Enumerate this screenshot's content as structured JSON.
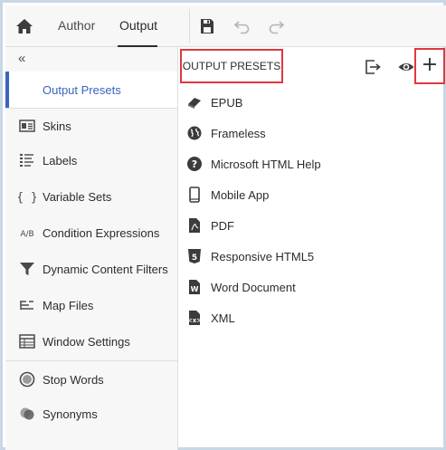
{
  "topbar": {
    "tabs": [
      {
        "label": "Author"
      },
      {
        "label": "Output"
      }
    ]
  },
  "sidebar": {
    "collapse_glyph": "«",
    "items": [
      {
        "label": "Output Presets",
        "icon": "output-presets-icon",
        "active": true
      },
      {
        "label": "Skins",
        "icon": "skins-icon"
      },
      {
        "label": "Labels",
        "icon": "labels-icon"
      },
      {
        "label": "Variable Sets",
        "icon": "variable-sets-icon"
      },
      {
        "label": "Condition Expressions",
        "icon": "condition-expressions-icon"
      },
      {
        "label": "Dynamic Content Filters",
        "icon": "filter-icon"
      },
      {
        "label": "Map Files",
        "icon": "map-files-icon"
      },
      {
        "label": "Window Settings",
        "icon": "window-settings-icon"
      },
      {
        "label": "Stop Words",
        "icon": "stop-words-icon"
      },
      {
        "label": "Synonyms",
        "icon": "synonyms-icon"
      }
    ]
  },
  "panel": {
    "title": "OUTPUT PRESETS",
    "presets": [
      {
        "label": "EPUB",
        "icon": "epub-icon"
      },
      {
        "label": "Frameless",
        "icon": "globe-icon"
      },
      {
        "label": "Microsoft HTML Help",
        "icon": "help-icon"
      },
      {
        "label": "Mobile App",
        "icon": "mobile-icon"
      },
      {
        "label": "PDF",
        "icon": "pdf-icon"
      },
      {
        "label": "Responsive HTML5",
        "icon": "html5-icon"
      },
      {
        "label": "Word Document",
        "icon": "word-icon"
      },
      {
        "label": "XML",
        "icon": "xml-icon"
      }
    ]
  },
  "colors": {
    "accent": "#3a64bd",
    "highlight_border": "#e0383e",
    "sidebar_bg": "#f7f7f7"
  }
}
